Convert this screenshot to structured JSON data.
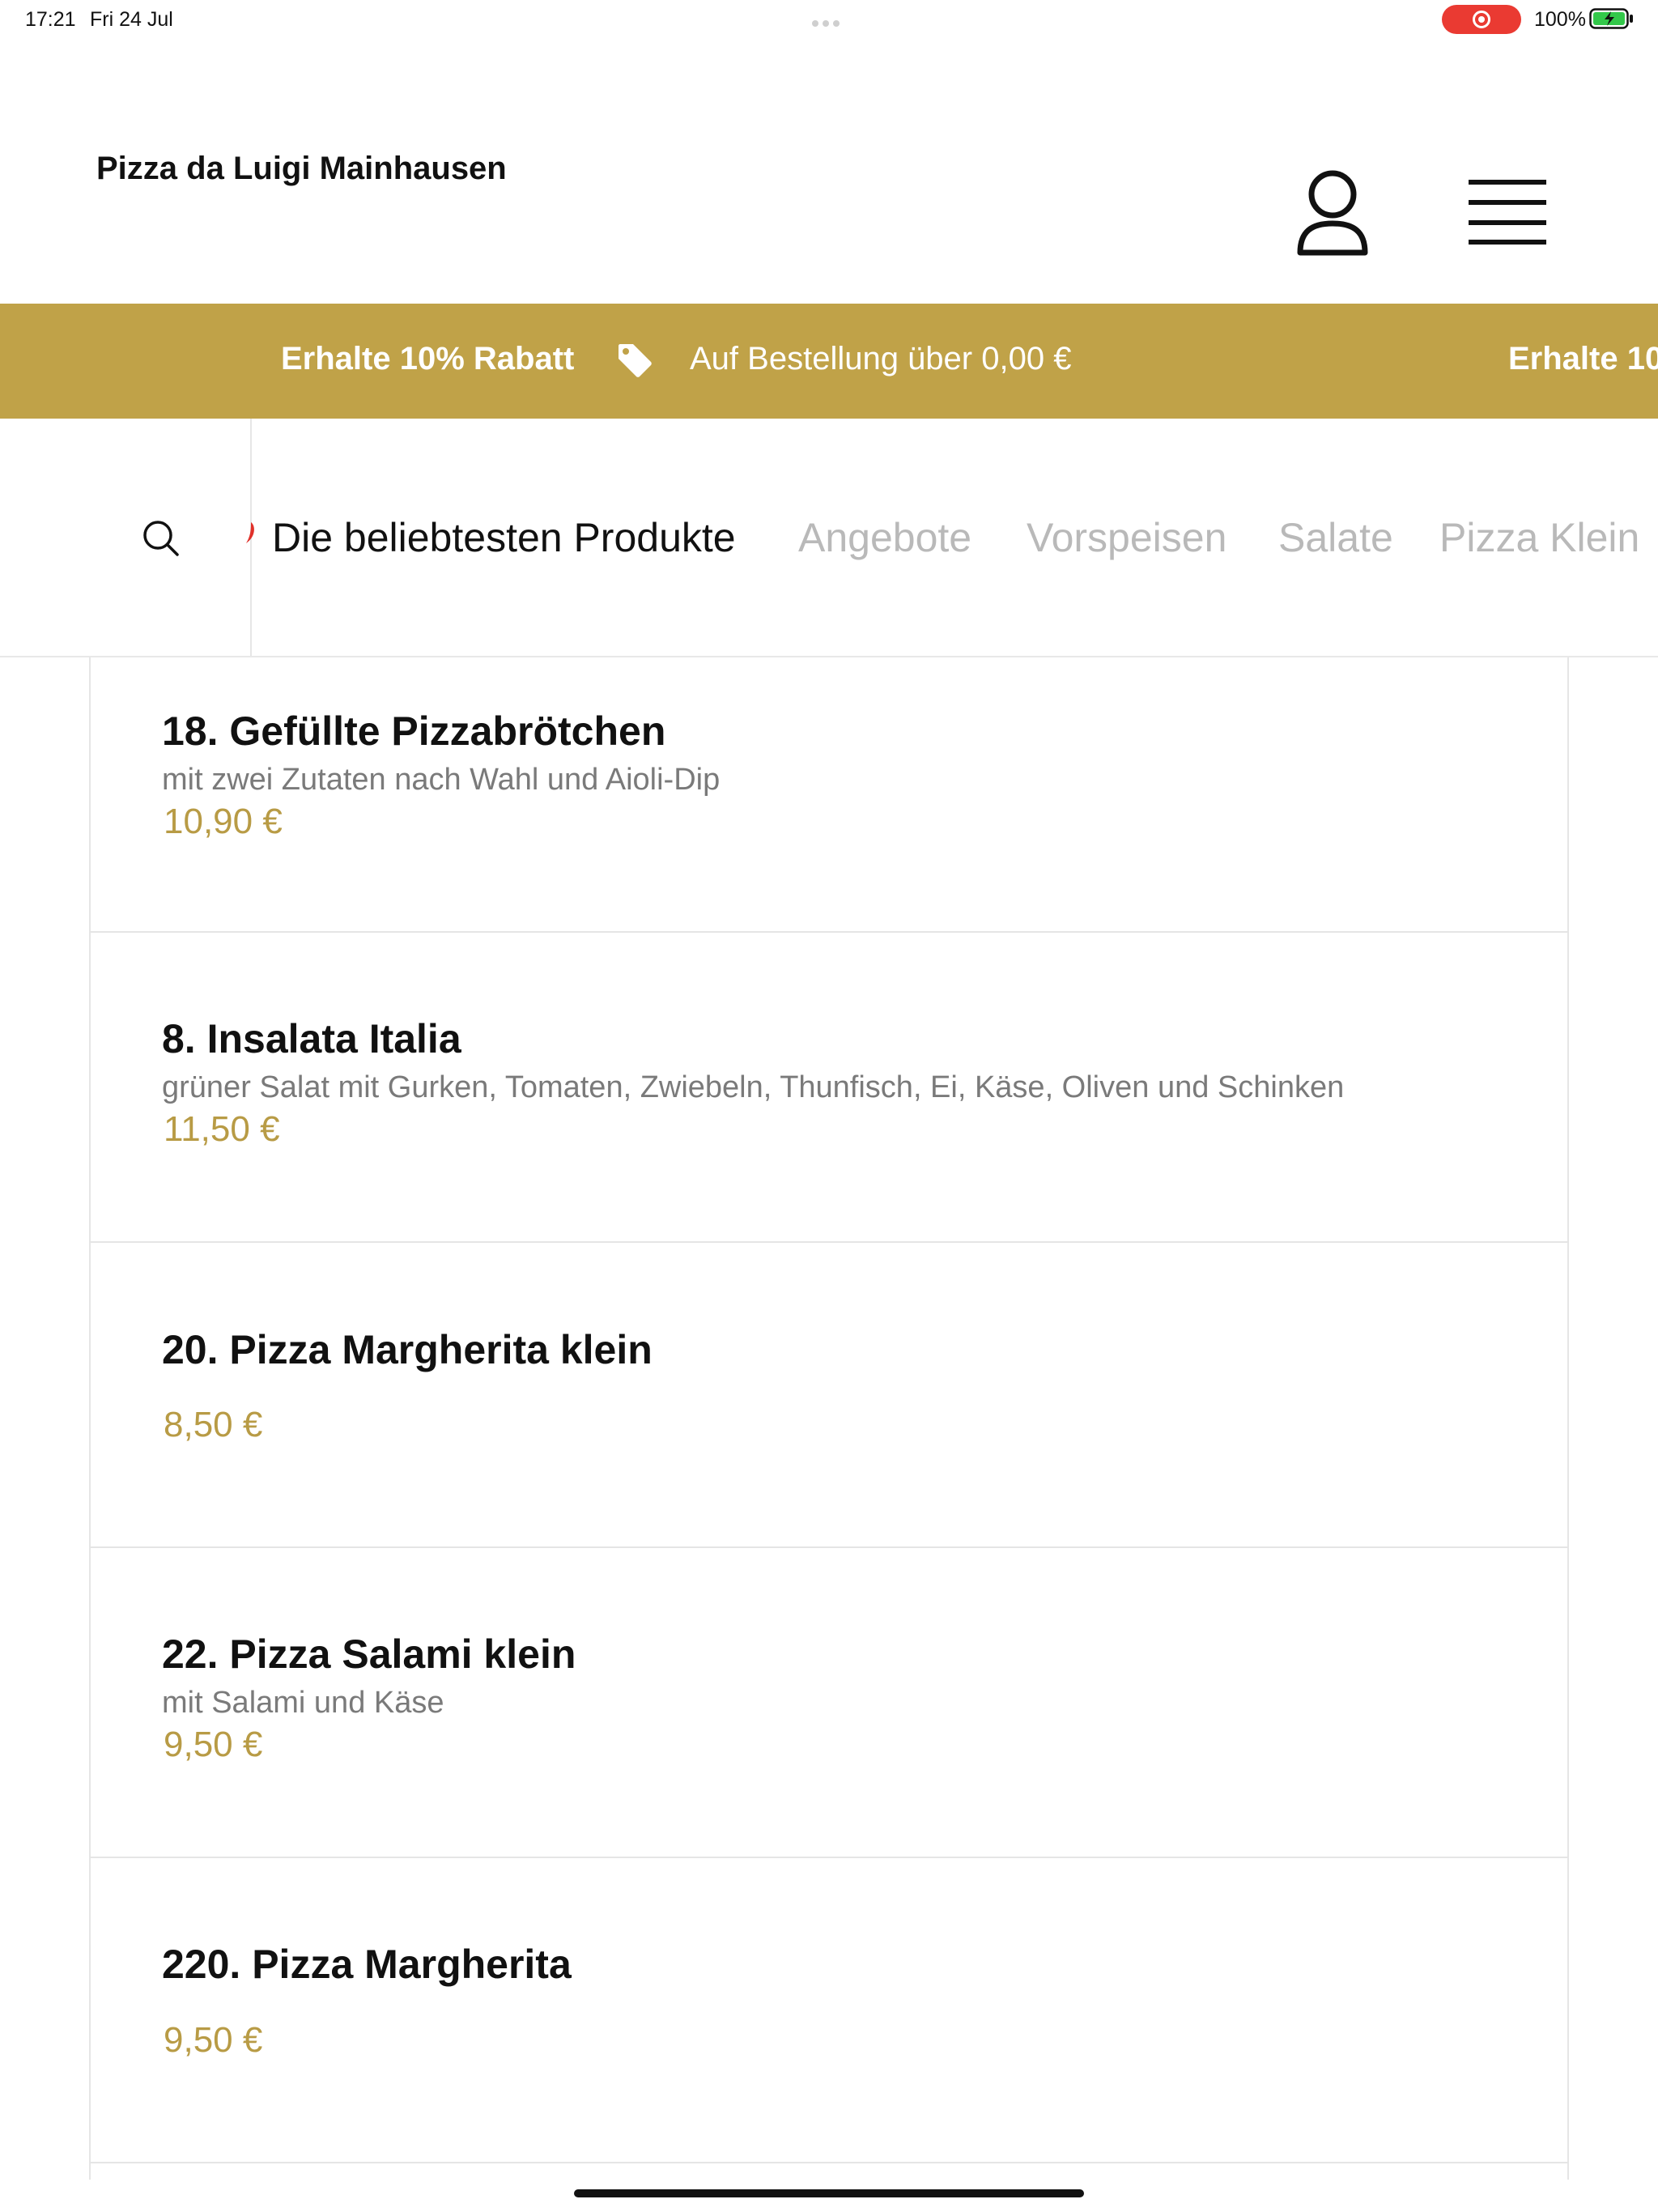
{
  "status_bar": {
    "time": "17:21",
    "date": "Fri 24 Jul",
    "battery_percent": "100%",
    "recording_color": "#ea3a32",
    "battery_color": "#33c84a"
  },
  "header": {
    "restaurant_name": "Pizza da Luigi Mainhausen",
    "account_icon": "user-icon",
    "menu_icon": "hamburger-menu-icon"
  },
  "promo": {
    "title": "Erhalte 10% Rabatt",
    "subtitle": "Auf Bestellung über 0,00 €",
    "title_repeat": "Erhalte 10",
    "icon": "tag-icon",
    "background_color": "#c0a248"
  },
  "categories": {
    "search_icon": "search-icon",
    "items": [
      {
        "label": "Die beliebtesten Produkte",
        "active": true
      },
      {
        "label": "Angebote",
        "active": false
      },
      {
        "label": "Vorspeisen",
        "active": false
      },
      {
        "label": "Salate",
        "active": false
      },
      {
        "label": "Pizza Klein",
        "active": false
      }
    ]
  },
  "products": [
    {
      "name": "18. Gefüllte Pizzabrötchen",
      "description": "mit zwei Zutaten nach Wahl und Aioli-Dip",
      "price": "10,90 €"
    },
    {
      "name": "8. Insalata Italia",
      "description": "grüner Salat mit Gurken, Tomaten, Zwiebeln, Thunfisch, Ei, Käse, Oliven und Schinken",
      "price": "11,50 €"
    },
    {
      "name": "20. Pizza Margherita klein",
      "description": "",
      "price": "8,50 €"
    },
    {
      "name": "22. Pizza Salami klein",
      "description": "mit Salami und Käse",
      "price": "9,50 €"
    },
    {
      "name": "220. Pizza Margherita",
      "description": "",
      "price": "9,50 €"
    }
  ],
  "colors": {
    "accent_gold": "#c0a248",
    "price_gold": "#b89b45",
    "inactive_category": "#b9b9b9"
  }
}
